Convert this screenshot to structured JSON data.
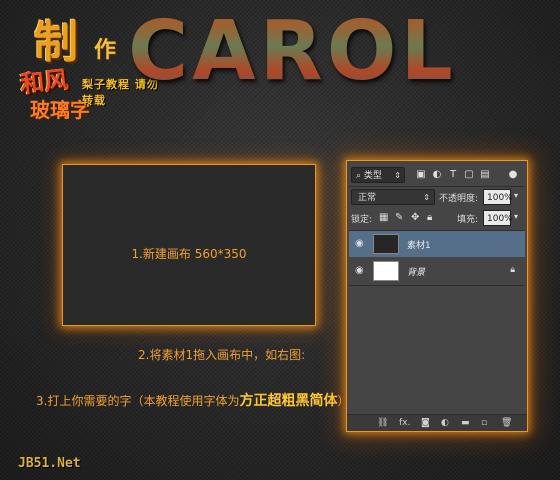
{
  "logo": {
    "zhi": "制",
    "zuo": "作",
    "hefeng": "和风",
    "boli": "玻璃字",
    "subtitle": "梨子教程 请勿转载"
  },
  "header": {
    "title": "CAROL"
  },
  "canvas": {
    "label": "1.新建画布 560*350"
  },
  "steps": {
    "step2": "2.将素材1拖入画布中，如右图:",
    "step3_prefix": "3.打上你需要的字（本教程使用字体为",
    "step3_font": "方正超粗黑简体",
    "step3_suffix": "）"
  },
  "panel": {
    "filter_label": "类型",
    "blend_mode": "正常",
    "opacity_label": "不透明度:",
    "opacity_value": "100%",
    "lock_label": "锁定:",
    "fill_label": "填充:",
    "fill_value": "100%",
    "layers": [
      {
        "name": "素材1",
        "selected": true
      },
      {
        "name": "背景",
        "selected": false
      }
    ]
  },
  "footer": {
    "watermark": "JB51.Net"
  },
  "colors": {
    "accent": "#e89a20",
    "label": "#f0a030",
    "selection": "#556e8a"
  }
}
